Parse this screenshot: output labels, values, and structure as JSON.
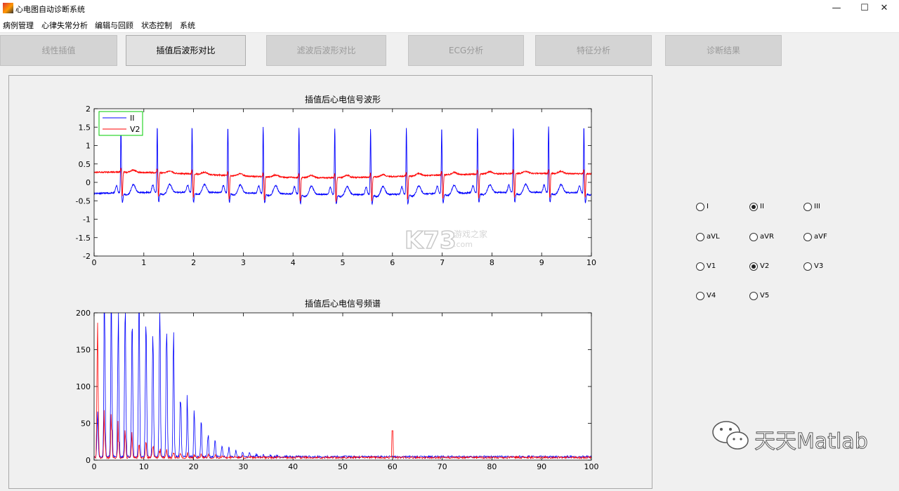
{
  "window": {
    "title": "心电图自动诊断系统",
    "minimize": "—",
    "maximize": "☐",
    "close": "✕"
  },
  "menu": [
    "病例管理",
    "心律失常分析",
    "编辑与回顾",
    "状态控制",
    "系统"
  ],
  "toolbar": [
    {
      "label": "线性插值",
      "active": false
    },
    {
      "label": "插值后波形对比",
      "active": true
    },
    {
      "label": "滤波后波形对比",
      "active": false
    },
    {
      "label": "ECG分析",
      "active": false
    },
    {
      "label": "特征分析",
      "active": false
    },
    {
      "label": "诊断结果",
      "active": false
    }
  ],
  "leads": [
    {
      "label": "I",
      "checked": false
    },
    {
      "label": "II",
      "checked": true
    },
    {
      "label": "III",
      "checked": false
    },
    {
      "label": "aVL",
      "checked": false
    },
    {
      "label": "aVR",
      "checked": false
    },
    {
      "label": "aVF",
      "checked": false
    },
    {
      "label": "V1",
      "checked": false
    },
    {
      "label": "V2",
      "checked": true
    },
    {
      "label": "V3",
      "checked": false
    },
    {
      "label": "V4",
      "checked": false
    },
    {
      "label": "V5",
      "checked": false
    }
  ],
  "watermark": {
    "text": "天天Matlab",
    "k73": "K73",
    "k73_sub": "游戏之家",
    "k73_url": ".com"
  },
  "colors": {
    "series_ii": "#0000ff",
    "series_v2": "#ff0000",
    "legend_border": "#00cc00"
  },
  "chart_data": [
    {
      "type": "line",
      "title": "插值后心电信号波形",
      "xlabel": "",
      "ylabel": "",
      "xlim": [
        0,
        10
      ],
      "ylim": [
        -2,
        2
      ],
      "xticks": [
        0,
        1,
        2,
        3,
        4,
        5,
        6,
        7,
        8,
        9,
        10
      ],
      "yticks": [
        -2,
        -1.5,
        -1,
        -0.5,
        0,
        0.5,
        1,
        1.5,
        2
      ],
      "legend": "top-left",
      "r_peaks": [
        0.54,
        1.27,
        1.97,
        2.69,
        3.4,
        4.12,
        4.84,
        5.56,
        6.28,
        6.99,
        7.71,
        8.43,
        9.14,
        9.85
      ],
      "series": [
        {
          "name": "II",
          "baseline": -0.3,
          "r_amplitude": 1.2,
          "s_min": -0.55
        },
        {
          "name": "V2",
          "baseline": 0.2,
          "r_amplitude": 0.15,
          "s_min": -0.45
        }
      ]
    },
    {
      "type": "line",
      "title": "插值后心电信号频谱",
      "xlabel": "",
      "ylabel": "",
      "xlim": [
        0,
        100
      ],
      "ylim": [
        0,
        200
      ],
      "xticks": [
        0,
        10,
        20,
        30,
        40,
        50,
        60,
        70,
        80,
        90,
        100
      ],
      "yticks": [
        0,
        50,
        100,
        150,
        200
      ],
      "peak_hz": 60,
      "peak_value": 40,
      "series": [
        {
          "name": "II",
          "harmonic_hz": 1.39,
          "decay_to_zero_hz": 35
        },
        {
          "name": "V2",
          "harmonic_hz": 1.39,
          "decay_to_zero_hz": 30
        }
      ]
    }
  ]
}
